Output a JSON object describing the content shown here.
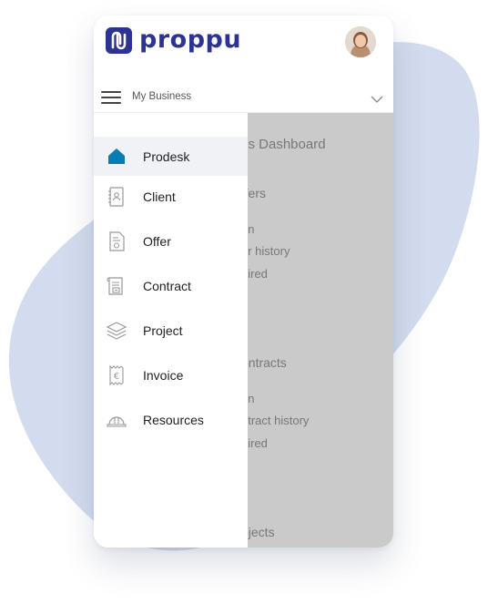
{
  "app": {
    "logo_text": "proppu",
    "brand_color": "#2d3392"
  },
  "business": {
    "label": "My Business"
  },
  "menu": {
    "items": [
      {
        "label": "Prodesk",
        "icon": "home-icon",
        "active": true
      },
      {
        "label": "Client",
        "icon": "contact-book-icon",
        "active": false
      },
      {
        "label": "Offer",
        "icon": "document-icon",
        "active": false
      },
      {
        "label": "Contract",
        "icon": "contract-icon",
        "active": false
      },
      {
        "label": "Project",
        "icon": "layers-icon",
        "active": false
      },
      {
        "label": "Invoice",
        "icon": "euro-receipt-icon",
        "active": false
      },
      {
        "label": "Resources",
        "icon": "hard-hat-icon",
        "active": false
      }
    ]
  },
  "dashboard": {
    "title_partial": "ss Dashboard",
    "offers_heading_partial": "ffers",
    "offers_items": [
      "en",
      "er history",
      "pired"
    ],
    "contracts_heading_partial": "ontracts",
    "contracts_items": [
      "en",
      "ntract history",
      "pired"
    ],
    "projects_heading_partial": "ojects"
  }
}
